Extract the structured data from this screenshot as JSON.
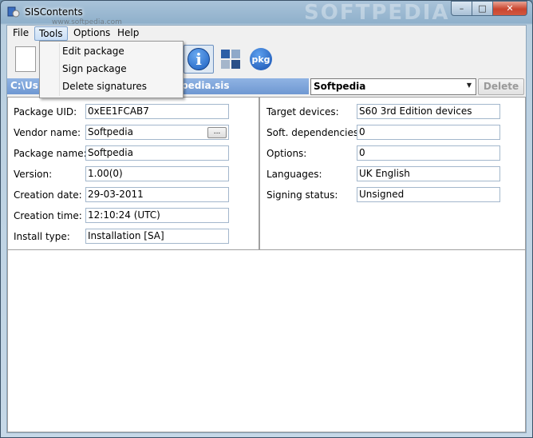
{
  "window": {
    "title": "SISContents",
    "watermark": "SOFTPEDIA",
    "watermark_url": "www.softpedia.com"
  },
  "menubar": {
    "file": "File",
    "tools": "Tools",
    "options": "Options",
    "help": "Help"
  },
  "tools_menu": {
    "items": [
      "Edit package",
      "Sign package",
      "Delete signatures"
    ]
  },
  "toolbar": {
    "pkg_label": "pkg"
  },
  "pathbar": {
    "left": "C:\\Us",
    "right": "oftpedia.sis"
  },
  "signer_combo": {
    "value": "Softpedia"
  },
  "delete_label": "Delete",
  "left_fields": [
    {
      "label": "Package UID:",
      "value": "0xEE1FCAB7"
    },
    {
      "label": "Vendor name:",
      "value": "Softpedia"
    },
    {
      "label": "Package name:",
      "value": "Softpedia"
    },
    {
      "label": "Version:",
      "value": "1.00(0)"
    },
    {
      "label": "Creation date:",
      "value": "29-03-2011"
    },
    {
      "label": "Creation time:",
      "value": "12:10:24 (UTC)"
    },
    {
      "label": "Install type:",
      "value": "Installation [SA]"
    }
  ],
  "right_fields": [
    {
      "label": "Target devices:",
      "value": "S60 3rd Edition devices"
    },
    {
      "label": "Soft. dependencies:",
      "value": "0"
    },
    {
      "label": "Options:",
      "value": "0"
    },
    {
      "label": "Languages:",
      "value": "UK English"
    },
    {
      "label": "Signing status:",
      "value": "Unsigned"
    }
  ],
  "vendor_browse_label": "...",
  "colors": {
    "pathbar": "#7aa2d8",
    "title_gradient": "#a9c3d9",
    "close_button": "#c9452f"
  }
}
